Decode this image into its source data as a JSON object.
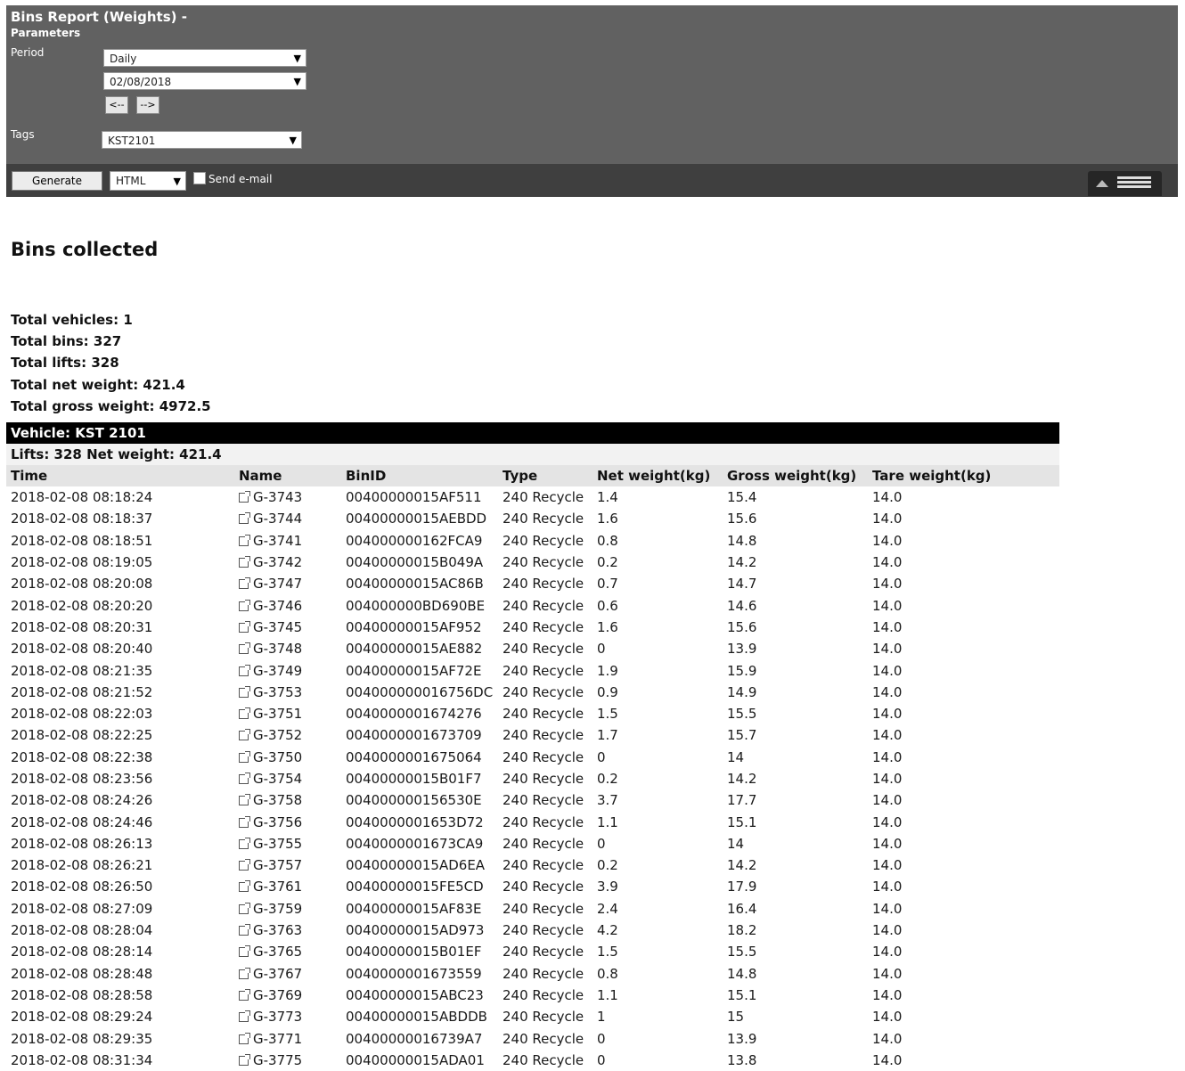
{
  "params": {
    "title": "Bins Report (Weights) -",
    "subtitle": "Parameters",
    "period_label": "Period",
    "period_value": "Daily",
    "date_value": "02/08/2018",
    "prev_label": "<--",
    "next_label": "-->",
    "tags_label": "Tags",
    "tags_value": "KST2101",
    "generate_label": "Generate",
    "format_value": "HTML",
    "send_email_label": "Send e-mail"
  },
  "report": {
    "heading": "Bins collected",
    "total_vehicles": "Total vehicles: 1",
    "total_bins": "Total bins: 327",
    "total_lifts": "Total lifts: 328",
    "total_net_weight": "Total net weight: 421.4",
    "total_gross_weight": "Total gross weight: 4972.5",
    "vehicle_header": "Vehicle: KST 2101",
    "lifts_summary": "Lifts: 328 Net weight: 421.4"
  },
  "table": {
    "headers": [
      "Time",
      "Name",
      "BinID",
      "Type",
      "Net weight(kg)",
      "Gross weight(kg)",
      "Tare weight(kg)"
    ],
    "rows": [
      [
        "2018-02-08 08:18:24",
        "G-3743",
        "00400000015AF511",
        "240 Recycle",
        "1.4",
        "15.4",
        "14.0"
      ],
      [
        "2018-02-08 08:18:37",
        "G-3744",
        "00400000015AEBDD",
        "240 Recycle",
        "1.6",
        "15.6",
        "14.0"
      ],
      [
        "2018-02-08 08:18:51",
        "G-3741",
        "004000000162FCA9",
        "240 Recycle",
        "0.8",
        "14.8",
        "14.0"
      ],
      [
        "2018-02-08 08:19:05",
        "G-3742",
        "00400000015B049A",
        "240 Recycle",
        "0.2",
        "14.2",
        "14.0"
      ],
      [
        "2018-02-08 08:20:08",
        "G-3747",
        "00400000015AC86B",
        "240 Recycle",
        "0.7",
        "14.7",
        "14.0"
      ],
      [
        "2018-02-08 08:20:20",
        "G-3746",
        "004000000BD690BE",
        "240 Recycle",
        "0.6",
        "14.6",
        "14.0"
      ],
      [
        "2018-02-08 08:20:31",
        "G-3745",
        "00400000015AF952",
        "240 Recycle",
        "1.6",
        "15.6",
        "14.0"
      ],
      [
        "2018-02-08 08:20:40",
        "G-3748",
        "00400000015AE882",
        "240 Recycle",
        "0",
        "13.9",
        "14.0"
      ],
      [
        "2018-02-08 08:21:35",
        "G-3749",
        "00400000015AF72E",
        "240 Recycle",
        "1.9",
        "15.9",
        "14.0"
      ],
      [
        "2018-02-08 08:21:52",
        "G-3753",
        "004000000016756DC",
        "240 Recycle",
        "0.9",
        "14.9",
        "14.0"
      ],
      [
        "2018-02-08 08:22:03",
        "G-3751",
        "0040000001674276",
        "240 Recycle",
        "1.5",
        "15.5",
        "14.0"
      ],
      [
        "2018-02-08 08:22:25",
        "G-3752",
        "0040000001673709",
        "240 Recycle",
        "1.7",
        "15.7",
        "14.0"
      ],
      [
        "2018-02-08 08:22:38",
        "G-3750",
        "0040000001675064",
        "240 Recycle",
        "0",
        "14",
        "14.0"
      ],
      [
        "2018-02-08 08:23:56",
        "G-3754",
        "00400000015B01F7",
        "240 Recycle",
        "0.2",
        "14.2",
        "14.0"
      ],
      [
        "2018-02-08 08:24:26",
        "G-3758",
        "004000000156530E",
        "240 Recycle",
        "3.7",
        "17.7",
        "14.0"
      ],
      [
        "2018-02-08 08:24:46",
        "G-3756",
        "0040000001653D72",
        "240 Recycle",
        "1.1",
        "15.1",
        "14.0"
      ],
      [
        "2018-02-08 08:26:13",
        "G-3755",
        "0040000001673CA9",
        "240 Recycle",
        "0",
        "14",
        "14.0"
      ],
      [
        "2018-02-08 08:26:21",
        "G-3757",
        "00400000015AD6EA",
        "240 Recycle",
        "0.2",
        "14.2",
        "14.0"
      ],
      [
        "2018-02-08 08:26:50",
        "G-3761",
        "00400000015FE5CD",
        "240 Recycle",
        "3.9",
        "17.9",
        "14.0"
      ],
      [
        "2018-02-08 08:27:09",
        "G-3759",
        "00400000015AF83E",
        "240 Recycle",
        "2.4",
        "16.4",
        "14.0"
      ],
      [
        "2018-02-08 08:28:04",
        "G-3763",
        "00400000015AD973",
        "240 Recycle",
        "4.2",
        "18.2",
        "14.0"
      ],
      [
        "2018-02-08 08:28:14",
        "G-3765",
        "00400000015B01EF",
        "240 Recycle",
        "1.5",
        "15.5",
        "14.0"
      ],
      [
        "2018-02-08 08:28:48",
        "G-3767",
        "0040000001673559",
        "240 Recycle",
        "0.8",
        "14.8",
        "14.0"
      ],
      [
        "2018-02-08 08:28:58",
        "G-3769",
        "00400000015ABC23",
        "240 Recycle",
        "1.1",
        "15.1",
        "14.0"
      ],
      [
        "2018-02-08 08:29:24",
        "G-3773",
        "00400000015ABDDB",
        "240 Recycle",
        "1",
        "15",
        "14.0"
      ],
      [
        "2018-02-08 08:29:35",
        "G-3771",
        "00400000016739A7",
        "240 Recycle",
        "0",
        "13.9",
        "14.0"
      ],
      [
        "2018-02-08 08:31:34",
        "G-3775",
        "00400000015ADA01",
        "240 Recycle",
        "0",
        "13.8",
        "14.0"
      ]
    ]
  }
}
